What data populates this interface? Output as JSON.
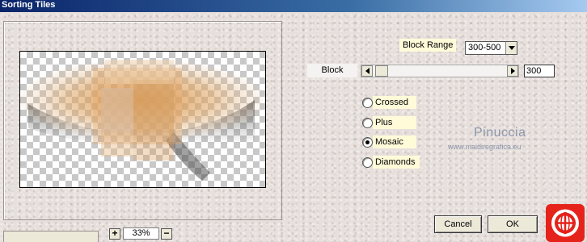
{
  "window": {
    "title": "Sorting Tiles"
  },
  "preview": {
    "zoom_in": "+",
    "zoom_value": "33%",
    "zoom_out": "−"
  },
  "block_range": {
    "label": "Block Range",
    "selected": "300-500"
  },
  "block": {
    "label": "Block",
    "value": "300",
    "slider_level": 0.02
  },
  "mode": {
    "options": [
      "Crossed",
      "Plus",
      "Mosaic",
      "Diamonds"
    ],
    "selected": "Mosaic"
  },
  "watermark": {
    "name": "Pinuccia",
    "url": "www.maidiregrafica.eu"
  },
  "buttons": {
    "cancel": "Cancel",
    "ok": "OK"
  },
  "colors": {
    "title_bar": "#0a246a",
    "label_bg": "#fffbd9",
    "logo_red": "#e5231b",
    "accent_orange": "#c8731f"
  },
  "icons": {
    "select_arrow": "triangle-down",
    "scroll_left": "triangle-left",
    "scroll_right": "triangle-right",
    "logo": "web-globe-icon"
  }
}
